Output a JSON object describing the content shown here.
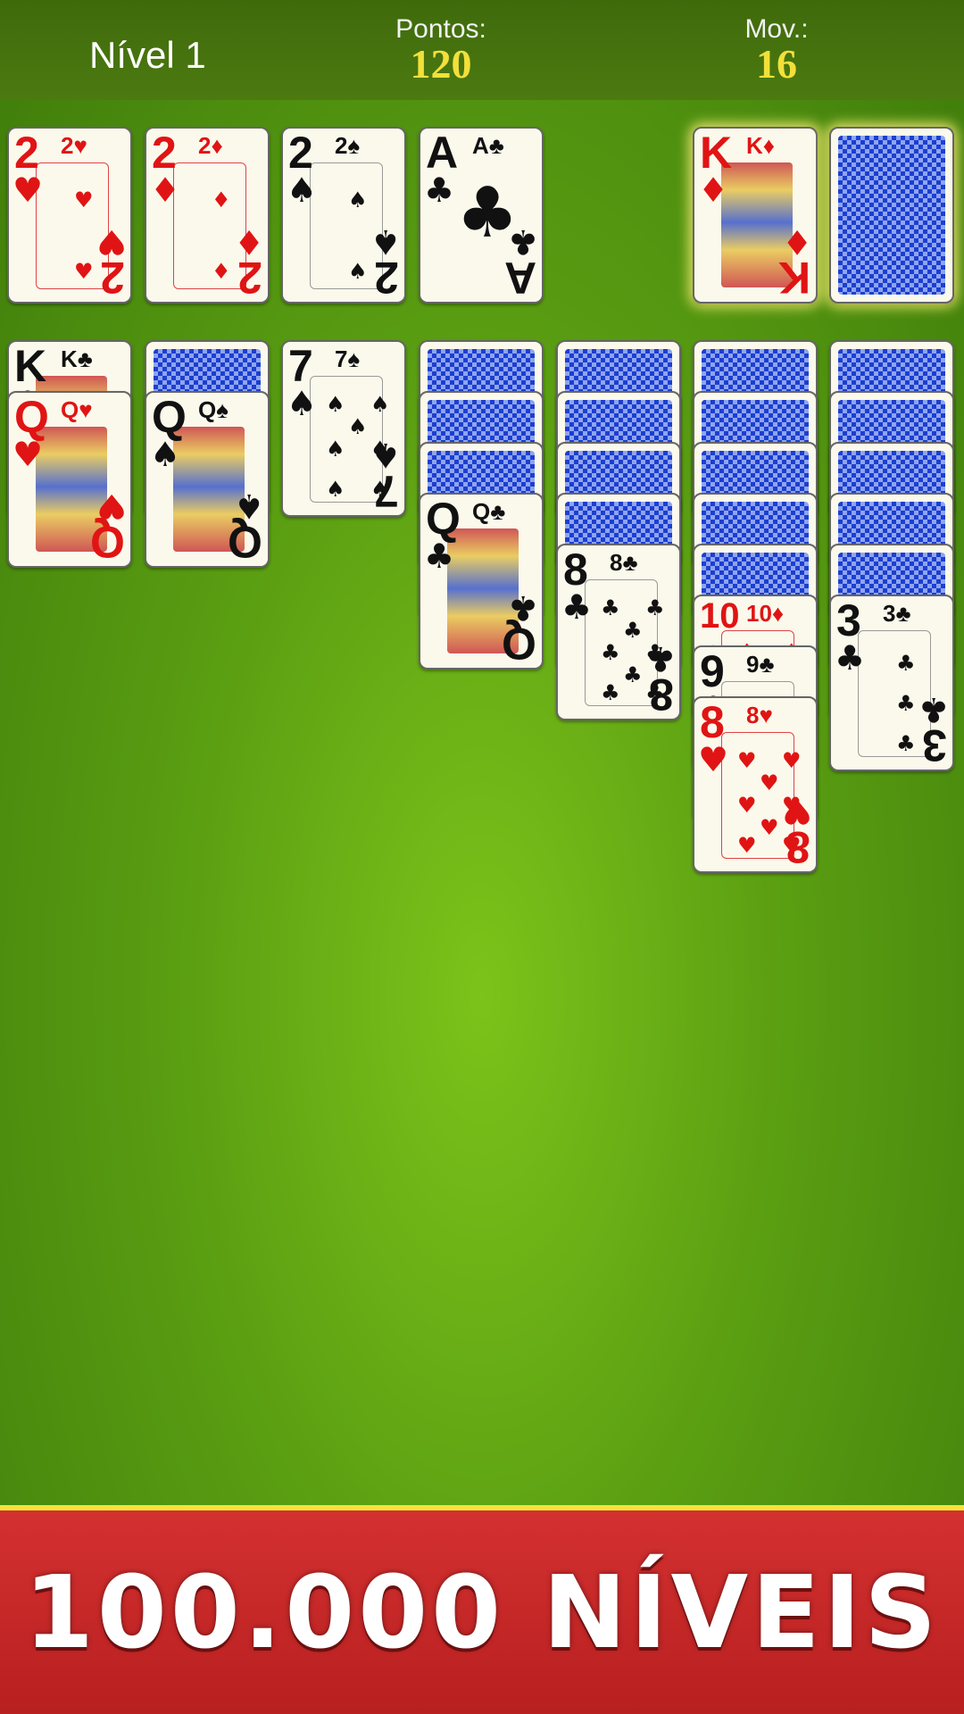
{
  "hud": {
    "level": "Nível 1",
    "score_label": "Pontos:",
    "score_value": "120",
    "moves_label": "Mov.:",
    "moves_value": "16"
  },
  "foundations": [
    {
      "rank": "2",
      "suit": "♥",
      "color": "red"
    },
    {
      "rank": "2",
      "suit": "♦",
      "color": "red"
    },
    {
      "rank": "2",
      "suit": "♠",
      "color": "black"
    },
    {
      "rank": "A",
      "suit": "♣",
      "color": "black"
    }
  ],
  "waste": {
    "rank": "K",
    "suit": "♦",
    "color": "red"
  },
  "stock": {
    "face_down": true
  },
  "tableau": [
    {
      "cards": [
        {
          "rank": "K",
          "suit": "♣",
          "color": "black"
        },
        {
          "rank": "Q",
          "suit": "♥",
          "color": "red"
        }
      ]
    },
    {
      "cards": [
        {
          "back": true
        },
        {
          "rank": "Q",
          "suit": "♠",
          "color": "black"
        }
      ]
    },
    {
      "cards": [
        {
          "rank": "7",
          "suit": "♠",
          "color": "black"
        }
      ]
    },
    {
      "cards": [
        {
          "back": true
        },
        {
          "back": true
        },
        {
          "back": true
        },
        {
          "rank": "Q",
          "suit": "♣",
          "color": "black"
        }
      ]
    },
    {
      "cards": [
        {
          "back": true
        },
        {
          "back": true
        },
        {
          "back": true
        },
        {
          "back": true
        },
        {
          "rank": "8",
          "suit": "♣",
          "color": "black"
        }
      ]
    },
    {
      "cards": [
        {
          "back": true
        },
        {
          "back": true
        },
        {
          "back": true
        },
        {
          "back": true
        },
        {
          "back": true
        },
        {
          "rank": "10",
          "suit": "♦",
          "color": "red"
        },
        {
          "rank": "9",
          "suit": "♣",
          "color": "black"
        },
        {
          "rank": "8",
          "suit": "♥",
          "color": "red"
        }
      ]
    },
    {
      "cards": [
        {
          "back": true
        },
        {
          "back": true
        },
        {
          "back": true
        },
        {
          "back": true
        },
        {
          "back": true
        },
        {
          "rank": "3",
          "suit": "♣",
          "color": "black"
        }
      ]
    }
  ],
  "banner": {
    "text": "100.000 NÍVEIS"
  },
  "colors": {
    "felt": "#6bb317",
    "topbar": "#456f0e",
    "banner": "#c62828",
    "card_back": "#1c3fd0",
    "red_suit": "#e01414"
  }
}
